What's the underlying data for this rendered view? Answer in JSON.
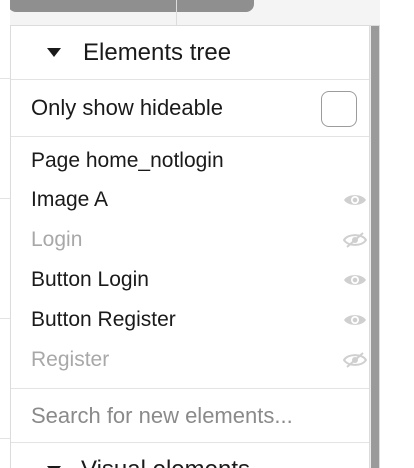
{
  "panel": {
    "section_title": "Elements tree",
    "toggle": {
      "label": "Only show hideable",
      "checked": false
    },
    "tree_items": [
      {
        "label": "Page home_notlogin",
        "hidden": false,
        "eye": "none"
      },
      {
        "label": "Image A",
        "hidden": false,
        "eye": "eye-icon"
      },
      {
        "label": "Login",
        "hidden": true,
        "eye": "eye-slash-icon"
      },
      {
        "label": "Button Login",
        "hidden": false,
        "eye": "eye-icon"
      },
      {
        "label": "Button Register",
        "hidden": false,
        "eye": "eye-icon"
      },
      {
        "label": "Register",
        "hidden": true,
        "eye": "eye-slash-icon"
      }
    ],
    "search": {
      "placeholder": "Search for new elements...",
      "value": ""
    },
    "next_section_title": "Visual elements"
  },
  "colors": {
    "text": "#1a1a1a",
    "hidden_text": "#a8a8a8",
    "eye_icon": "#cfcfcf",
    "divider": "#e3e3e3",
    "scroll_thumb": "#9a9a9a"
  }
}
